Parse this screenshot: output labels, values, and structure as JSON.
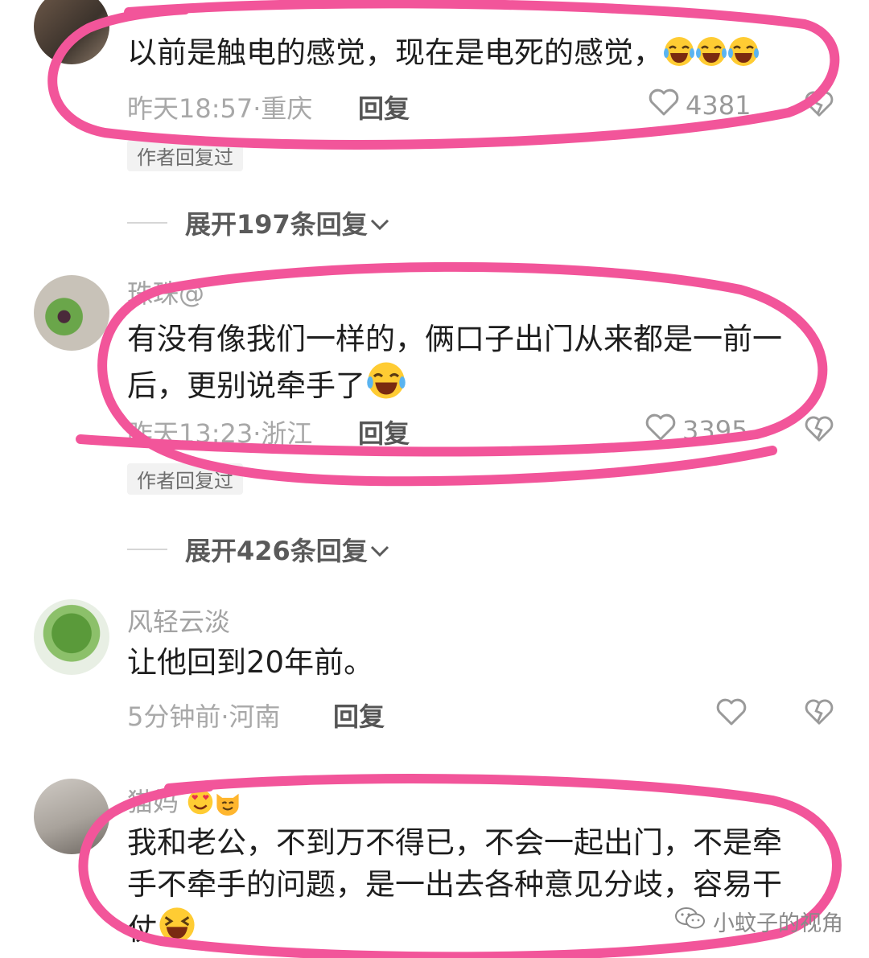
{
  "comments": [
    {
      "username": "",
      "text_lines": [
        "以前是触电的感觉，现在是电死的感觉，"
      ],
      "time_location": "昨天18:57·重庆",
      "reply_label": "回复",
      "likes": "4381",
      "author_tag": "作者回复过",
      "expand_label": "展开197条回复"
    },
    {
      "username": "珠珠@",
      "text_lines": [
        "有没有像我们一样的，俩口子出门从来都是一前一",
        "后，更别说牵手了"
      ],
      "time_location": "昨天13:23·浙江",
      "reply_label": "回复",
      "likes": "3395",
      "author_tag": "作者回复过",
      "expand_label": "展开426条回复"
    },
    {
      "username": "风轻云淡",
      "text_lines": [
        "让他回到20年前。"
      ],
      "time_location": "5分钟前·河南",
      "reply_label": "回复",
      "likes": ""
    },
    {
      "username": "猫妈",
      "text_lines": [
        "我和老公，不到万不得已，不会一起出门，不是牵",
        "手不牵手的问题，是一出去各种意见分歧，容易干",
        "仗"
      ]
    }
  ],
  "watermark": "小蚊子的视角",
  "colors": {
    "highlight_ring": "#f2559a",
    "emoji_yellow": "#ffcc33"
  }
}
